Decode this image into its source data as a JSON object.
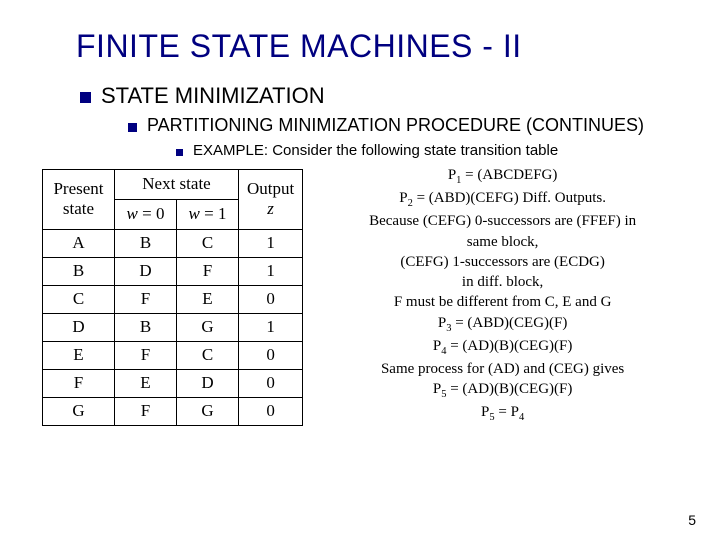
{
  "title": "FINITE STATE MACHINES - II",
  "h1": "STATE MINIMIZATION",
  "h2": "PARTITIONING MINIMIZATION PROCEDURE (CONTINUES)",
  "h3": "EXAMPLE: Consider the following state transition table",
  "table": {
    "head_present": "Present state",
    "head_next": "Next state",
    "head_output": "Output",
    "output_var": "z",
    "w0_var": "w",
    "w0_eq": " = 0",
    "w1_var": "w",
    "w1_eq": " = 1",
    "rows": [
      {
        "ps": "A",
        "w0": "B",
        "w1": "C",
        "z": "1"
      },
      {
        "ps": "B",
        "w0": "D",
        "w1": "F",
        "z": "1"
      },
      {
        "ps": "C",
        "w0": "F",
        "w1": "E",
        "z": "0"
      },
      {
        "ps": "D",
        "w0": "B",
        "w1": "G",
        "z": "1"
      },
      {
        "ps": "E",
        "w0": "F",
        "w1": "C",
        "z": "0"
      },
      {
        "ps": "F",
        "w0": "E",
        "w1": "D",
        "z": "0"
      },
      {
        "ps": "G",
        "w0": "F",
        "w1": "G",
        "z": "0"
      }
    ]
  },
  "notes": {
    "l1a": "P",
    "l1b": "1",
    "l1c": " = (ABCDEFG)",
    "l2a": "P",
    "l2b": "2",
    "l2c": " = (ABD)(CEFG)  Diff. Outputs.",
    "l3": "Because (CEFG) 0-successors are (FFEF) in",
    "l4": "same block,",
    "l5": "(CEFG) 1-successors are (ECDG)",
    "l6": "in diff. block,",
    "l7": "F must be different from C, E and G",
    "l8a": "P",
    "l8b": "3",
    "l8c": " = (ABD)(CEG)(F)",
    "l9a": "P",
    "l9b": "4",
    "l9c": " = (AD)(B)(CEG)(F)",
    "l10": "Same process for  (AD) and (CEG) gives",
    "l11a": "P",
    "l11b": "5",
    "l11c": " = (AD)(B)(CEG)(F)",
    "l12a": "P",
    "l12b": "5",
    "l12c": " = P",
    "l12d": "4"
  },
  "page_number": "5"
}
